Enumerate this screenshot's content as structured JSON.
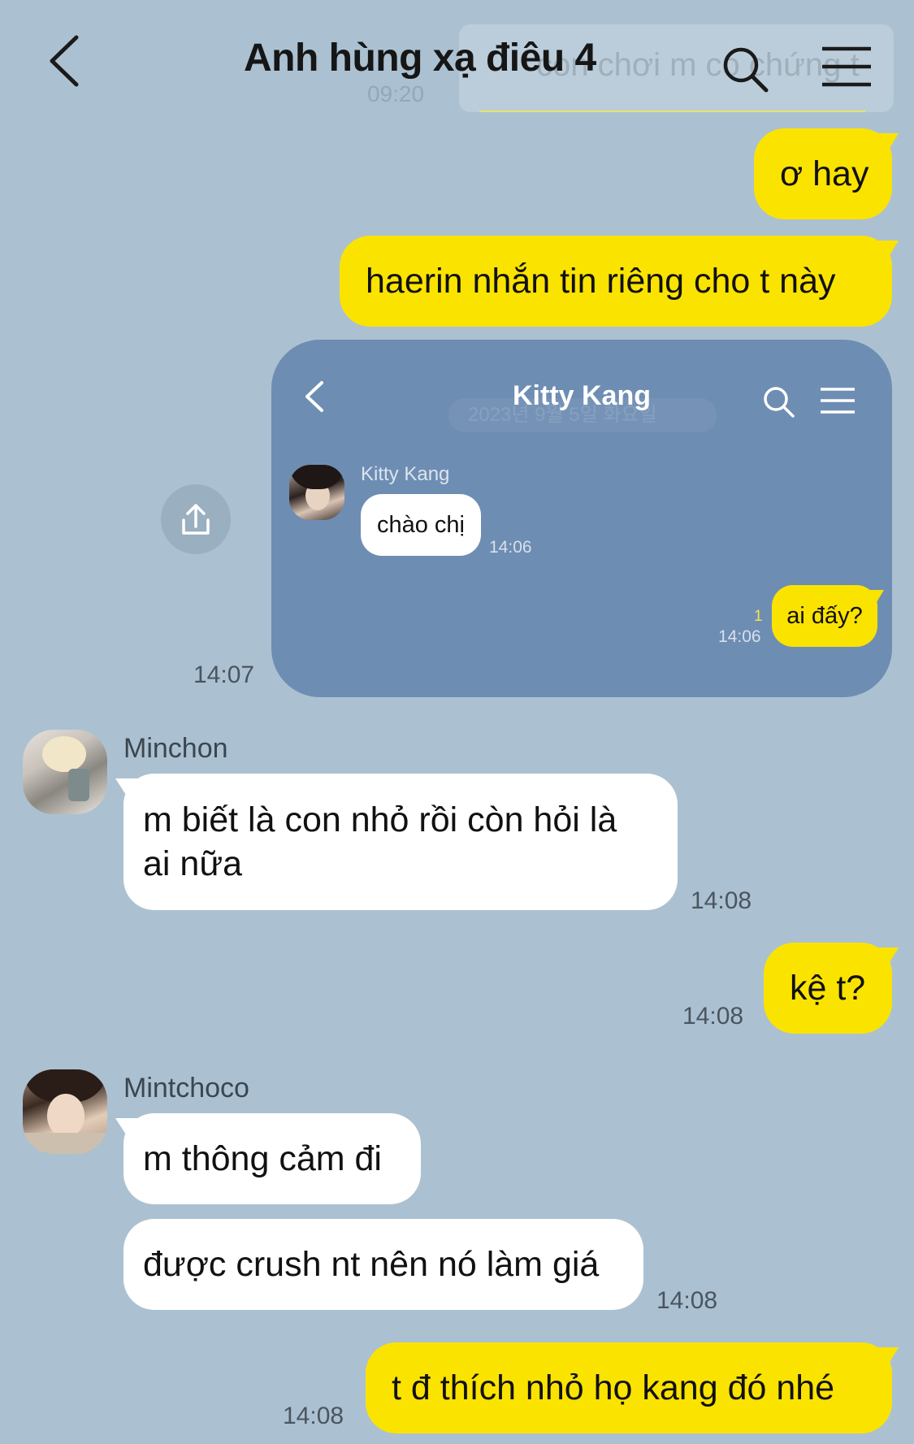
{
  "header": {
    "title": "Anh hùng xạ điêu 4",
    "back_icon": "chevron-left-icon",
    "search_icon": "search-icon",
    "menu_icon": "hamburger-menu-icon",
    "ghost_text": "con chơi m có chứng t",
    "ghost_time": "09:20"
  },
  "colors": {
    "background": "#abc1d1",
    "my_bubble": "#fbe300",
    "their_bubble": "#ffffff",
    "embedded_bg": "#6e8db3"
  },
  "messages": {
    "m1": {
      "text": "ơ hay"
    },
    "m2": {
      "text": "haerin nhắn tin riêng cho t này"
    },
    "m3": {
      "time": "14:07"
    },
    "m4": {
      "sender": "Minchon",
      "line1": "m biết là con nhỏ rồi còn hỏi là",
      "line2": "ai nữa",
      "time": "14:08"
    },
    "m5": {
      "text": "kệ t?",
      "time": "14:08"
    },
    "m6": {
      "sender": "Mintchoco",
      "text": "m thông cảm đi"
    },
    "m7": {
      "text": "được crush nt nên nó làm giá",
      "time": "14:08"
    },
    "m8": {
      "text": "t đ thích nhỏ họ kang đó nhé",
      "time": "14:08"
    }
  },
  "embedded": {
    "title": "Kitty Kang",
    "ghost_date": "2023년 9월 5일 화요일",
    "sender": "Kitty Kang",
    "msg_in": "chào chị",
    "msg_in_time": "14:06",
    "msg_out": "ai đấy?",
    "msg_out_unread": "1",
    "msg_out_time": "14:06"
  },
  "share_icon": "share-upload-icon"
}
